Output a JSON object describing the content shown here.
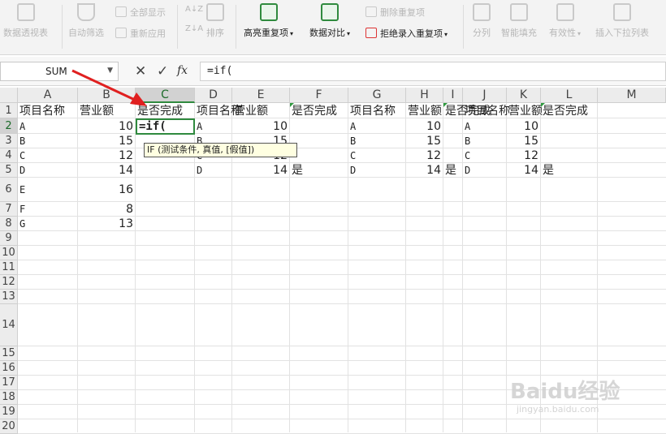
{
  "ribbon": {
    "pivot": "数据透视表",
    "autofilter": "自动筛选",
    "show_all": "全部显示",
    "reapply": "重新应用",
    "sort": "排序",
    "highlight_dup": "高亮重复项",
    "data_compare": "数据对比",
    "delete_dup": "删除重复项",
    "reject_dup": "拒绝录入重复项",
    "split": "分列",
    "smart_fill": "智能填充",
    "validity": "有效性",
    "insert_dropdown": "插入下拉列表",
    "sort_az": "A↓Z",
    "sort_za": "Z↓A"
  },
  "formula_bar": {
    "name_box": "SUM",
    "cancel": "✕",
    "confirm": "✓",
    "fx": "fx",
    "formula": "=if("
  },
  "columns": [
    "A",
    "B",
    "C",
    "D",
    "E",
    "F",
    "G",
    "H",
    "I",
    "J",
    "K",
    "L",
    "M"
  ],
  "rows": [
    "1",
    "2",
    "3",
    "4",
    "5",
    "6",
    "7",
    "8",
    "9",
    "10",
    "11",
    "12",
    "13",
    "14",
    "15",
    "16",
    "17",
    "18",
    "19",
    "20"
  ],
  "table1": {
    "headers": [
      "项目名称",
      "营业额",
      "是否完成"
    ],
    "names": [
      "A",
      "B",
      "C",
      "D",
      "E",
      "F",
      "G"
    ],
    "values": [
      "10",
      "15",
      "12",
      "14",
      "16",
      "8",
      "13"
    ]
  },
  "table2": {
    "headers": [
      "项目名称",
      "营业额",
      "是否完成"
    ],
    "names": [
      "A",
      "B",
      "C",
      "D"
    ],
    "values": [
      "10",
      "15",
      "12",
      "14"
    ],
    "done": [
      "",
      "",
      "",
      "是"
    ]
  },
  "table3": {
    "headers": [
      "项目名称",
      "营业额",
      "是否完成"
    ],
    "names": [
      "A",
      "B",
      "C",
      "D"
    ],
    "values": [
      "10",
      "15",
      "12",
      "14"
    ],
    "done": [
      "",
      "",
      "",
      "是"
    ]
  },
  "table4": {
    "headers": [
      "项目名称",
      "营业额",
      "是否完成"
    ],
    "names": [
      "A",
      "B",
      "C",
      "D"
    ],
    "values": [
      "10",
      "15",
      "12",
      "14"
    ],
    "done": [
      "",
      "",
      "",
      "是"
    ]
  },
  "active_cell_text": "=if(",
  "tooltip": "IF (测试条件, 真值, [假值])",
  "watermark": "Baidu经验",
  "watermark_url": "jingyan.baidu.com",
  "colors": {
    "accent_green": "#2f8a3e",
    "arrow_red": "#e02020",
    "tooltip_bg": "#ffffe1"
  }
}
